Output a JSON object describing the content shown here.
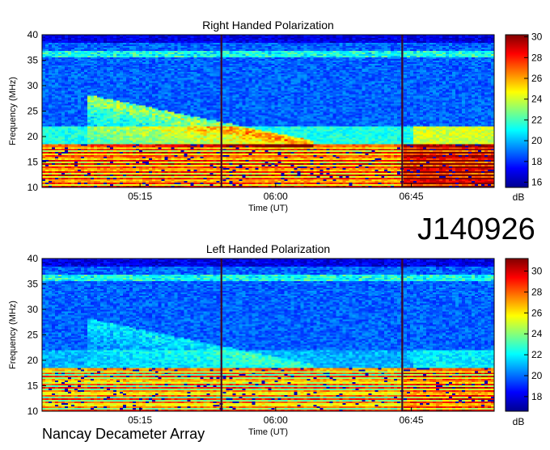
{
  "observation_id": "J140926",
  "observatory": "Nancay Decameter Array",
  "colorbar_unit": "dB",
  "chart_data": [
    {
      "type": "heatmap",
      "title": "Right Handed Polarization",
      "xlabel": "Time (UT)",
      "ylabel": "Frequency (MHz)",
      "ylim": [
        10,
        40
      ],
      "y_ticks": [
        "10",
        "15",
        "20",
        "25",
        "30",
        "35",
        "40"
      ],
      "x_ticks": [
        {
          "label": "05:15",
          "minutes": 315
        },
        {
          "label": "06:00",
          "minutes": 360
        },
        {
          "label": "06:45",
          "minutes": 405
        }
      ],
      "xlim_minutes": [
        282.5,
        432.5
      ],
      "colorbar": {
        "label": "dB",
        "range": [
          15.5,
          30.2
        ],
        "ticks": [
          "16",
          "18",
          "20",
          "22",
          "24",
          "26",
          "28",
          "30"
        ]
      },
      "vertical_lines_minutes": [
        342,
        402
      ]
    },
    {
      "type": "heatmap",
      "title": "Left Handed Polarization",
      "xlabel": "Time (UT)",
      "ylabel": "Frequency (MHz)",
      "ylim": [
        10,
        40
      ],
      "y_ticks": [
        "10",
        "15",
        "20",
        "25",
        "30",
        "35",
        "40"
      ],
      "x_ticks": [
        {
          "label": "05:15",
          "minutes": 315
        },
        {
          "label": "06:00",
          "minutes": 360
        },
        {
          "label": "06:45",
          "minutes": 405
        }
      ],
      "xlim_minutes": [
        282.5,
        432.5
      ],
      "colorbar": {
        "label": "dB",
        "range": [
          16.6,
          31.2
        ],
        "ticks": [
          "18",
          "20",
          "22",
          "24",
          "26",
          "28",
          "30"
        ]
      },
      "vertical_lines_minutes": [
        342,
        402
      ]
    }
  ]
}
